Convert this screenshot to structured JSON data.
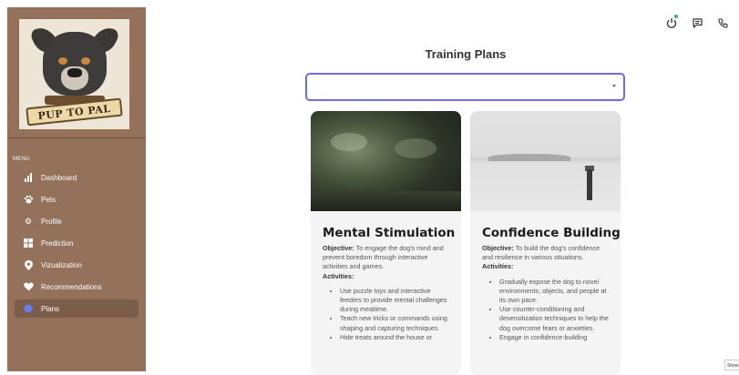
{
  "logo": {
    "brand_text": "PUP TO PAL"
  },
  "sidebar": {
    "menu_label": "MENU",
    "items": [
      {
        "label": "Dashboard",
        "icon": "bar-chart-icon",
        "glyph": "▮"
      },
      {
        "label": "Pets",
        "icon": "paw-icon",
        "glyph": "🐾"
      },
      {
        "label": "Profile",
        "icon": "gear-icon",
        "glyph": "⚙"
      },
      {
        "label": "Prediction",
        "icon": "grid-icon",
        "glyph": "▦"
      },
      {
        "label": "Vizualization",
        "icon": "location-pin-icon",
        "glyph": "⚲"
      },
      {
        "label": "Recommendations",
        "icon": "heart-icon",
        "glyph": "♥"
      },
      {
        "label": "Plans",
        "icon": "plans-dot-icon",
        "glyph": "●",
        "active": true
      }
    ]
  },
  "topbar": {
    "icons": [
      "power-icon",
      "chat-icon",
      "phone-icon"
    ],
    "glyphs": [
      "⏻",
      "▤",
      "✆"
    ],
    "status_color": "#2bb673"
  },
  "page": {
    "title": "Training Plans"
  },
  "select": {
    "value": ""
  },
  "cards": [
    {
      "title": "Mental Stimulation",
      "objective_label": "Objective:",
      "objective": "To engage the dog's mind and prevent boredom through interactive activities and games.",
      "activities_label": "Activities:",
      "activities": [
        "Use puzzle toys and interactive feeders to provide mental challenges during mealtime.",
        "Teach new tricks or commands using shaping and capturing techniques.",
        "Hide treats around the house or"
      ]
    },
    {
      "title": "Confidence Building",
      "objective_label": "Objective:",
      "objective": "To build the dog's confidence and resilience in various situations.",
      "activities_label": "Activities:",
      "activities": [
        "Gradually expose the dog to novel environments, objects, and people at its own pace.",
        "Use counter-conditioning and desensitization techniques to help the dog overcome fears or anxieties.",
        "Engage in confidence-building"
      ]
    }
  ],
  "footer": {
    "show_button": "Show"
  },
  "colors": {
    "sidebar": "#94715a",
    "accent": "#6c6ee0"
  }
}
